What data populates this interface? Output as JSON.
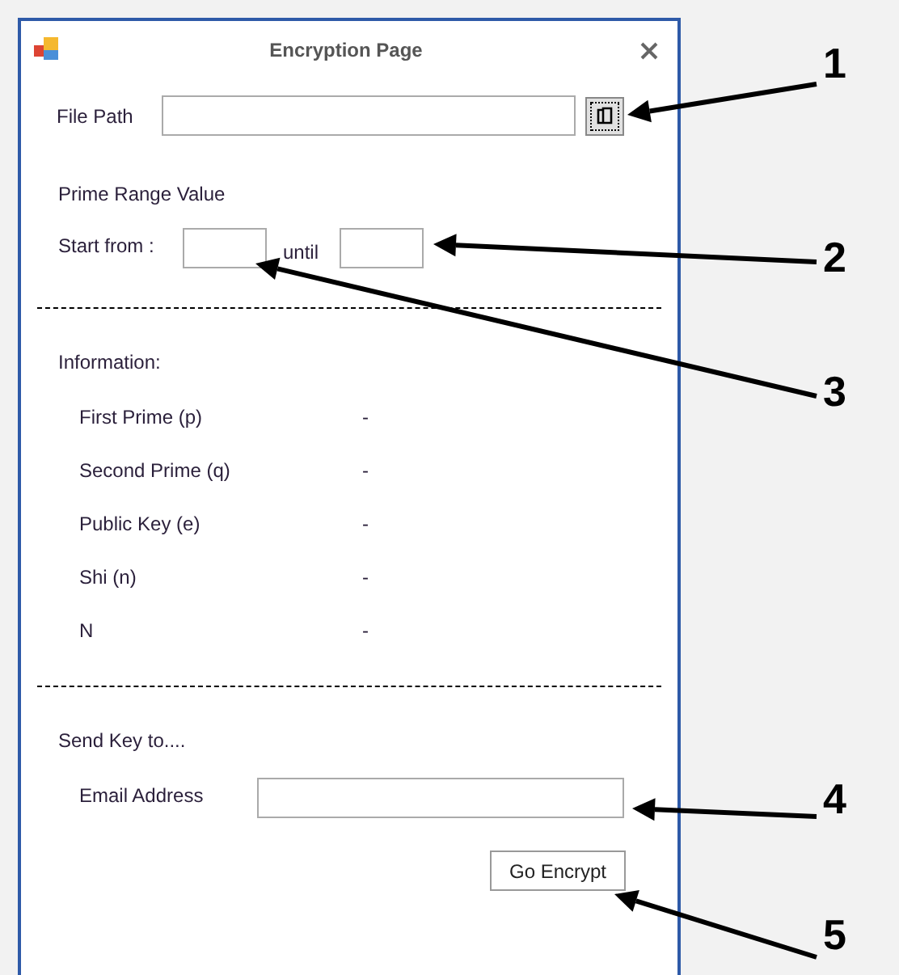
{
  "window": {
    "title": "Encryption Page"
  },
  "file_path": {
    "label": "File Path"
  },
  "prime_range": {
    "heading": "Prime Range Value",
    "start_label": "Start from :",
    "until_label": "until"
  },
  "information": {
    "heading": "Information:",
    "rows": [
      {
        "label": "First Prime (p)",
        "value": "-"
      },
      {
        "label": "Second Prime (q)",
        "value": "-"
      },
      {
        "label": "Public Key (e)",
        "value": "-"
      },
      {
        "label": "Shi (n)",
        "value": "-"
      },
      {
        "label": "N",
        "value": "-"
      }
    ]
  },
  "send_key": {
    "heading": "Send Key to....",
    "email_label": "Email Address",
    "button": "Go Encrypt"
  },
  "callouts": [
    "1",
    "2",
    "3",
    "4",
    "5"
  ]
}
